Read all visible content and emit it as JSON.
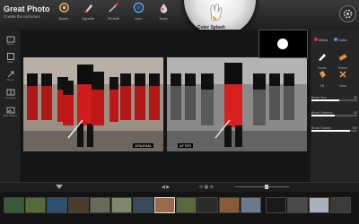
{
  "app": {
    "title": "Great Photo",
    "subtitle": "Create the extremes"
  },
  "toolbar": [
    {
      "label": "Bokeh"
    },
    {
      "label": "Vignette"
    },
    {
      "label": "Tilt-shift"
    },
    {
      "label": "Lens"
    },
    {
      "label": "Toner"
    },
    {
      "label": "Color Splash"
    },
    {
      "label": "Film"
    }
  ],
  "spotlight": {
    "label": "Color Splash"
  },
  "left_panel": [
    {
      "label": "Open"
    },
    {
      "label": "Save"
    },
    {
      "label": "Share"
    },
    {
      "label": "Compare"
    },
    {
      "label": "Edit Photos"
    }
  ],
  "canvas": {
    "before_tag": "ORIGINAL",
    "after_tag": "AFTER"
  },
  "right_panel": {
    "modes": [
      {
        "label": "Mono"
      },
      {
        "label": "Color"
      }
    ],
    "tools": [
      {
        "label": "Brush"
      },
      {
        "label": "Eraser"
      },
      {
        "label": "Fill"
      },
      {
        "label": "Clear"
      }
    ],
    "sliders": [
      {
        "label": "Brush Size",
        "value": "58",
        "level": 0.6
      },
      {
        "label": "Brush Softness",
        "value": "50",
        "level": 0.5
      },
      {
        "label": "Brush Opacity",
        "value": "100",
        "level": 0.85
      }
    ]
  },
  "colors": {
    "accent": "#e03030",
    "uniform": "#c01818",
    "panel": "#262626"
  },
  "controls": {
    "zoom": 0.55
  }
}
